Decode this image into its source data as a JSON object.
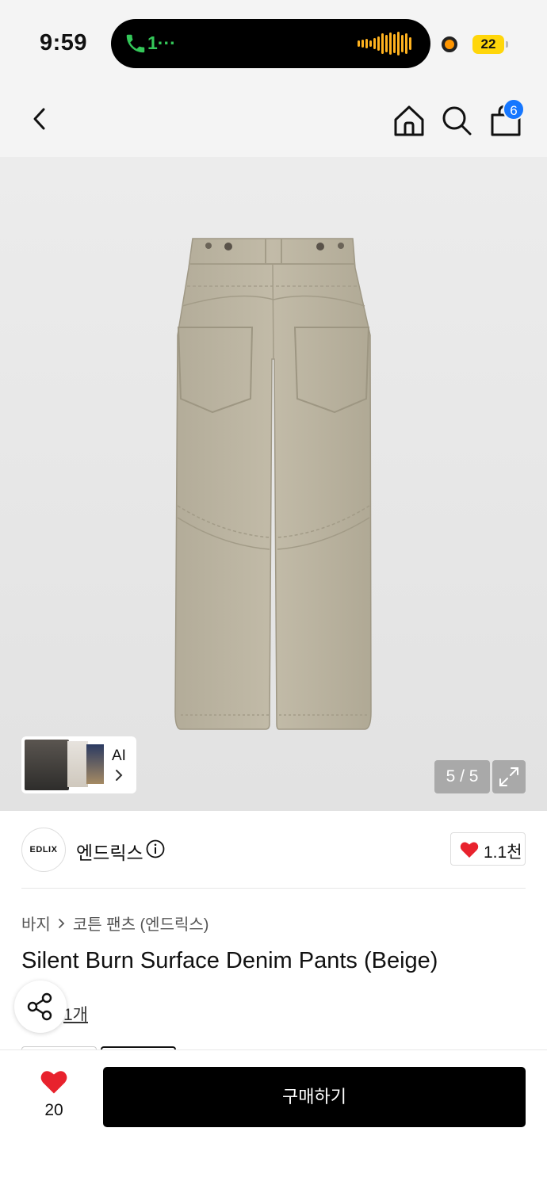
{
  "status_bar": {
    "time": "9:59",
    "call_text": "1···",
    "battery": "22"
  },
  "nav": {
    "cart_count": "6"
  },
  "gallery": {
    "ai_label": "AI",
    "counter": "5 / 5"
  },
  "brand": {
    "logo_text": "EDLIX",
    "name": "엔드릭스",
    "like_count": "1.1천"
  },
  "breadcrumb": {
    "category": "바지",
    "subcategory": "코튼 팬츠 (엔드릭스)"
  },
  "product": {
    "title": "Silent Burn Surface Denim Pants (Beige)",
    "review_suffix": "1개"
  },
  "bottom": {
    "wish_count": "20",
    "buy_label": "구매하기"
  },
  "colors": {
    "heart": "#e8222d",
    "badge": "#1677ff",
    "buy_button": "#000000",
    "pants": "#bdb6a4"
  },
  "icons": [
    "phone-icon",
    "waveform-icon",
    "back-arrow-icon",
    "home-icon",
    "search-icon",
    "shopping-bag-icon",
    "chevron-right-icon",
    "expand-icon",
    "info-icon",
    "heart-icon",
    "share-icon"
  ]
}
